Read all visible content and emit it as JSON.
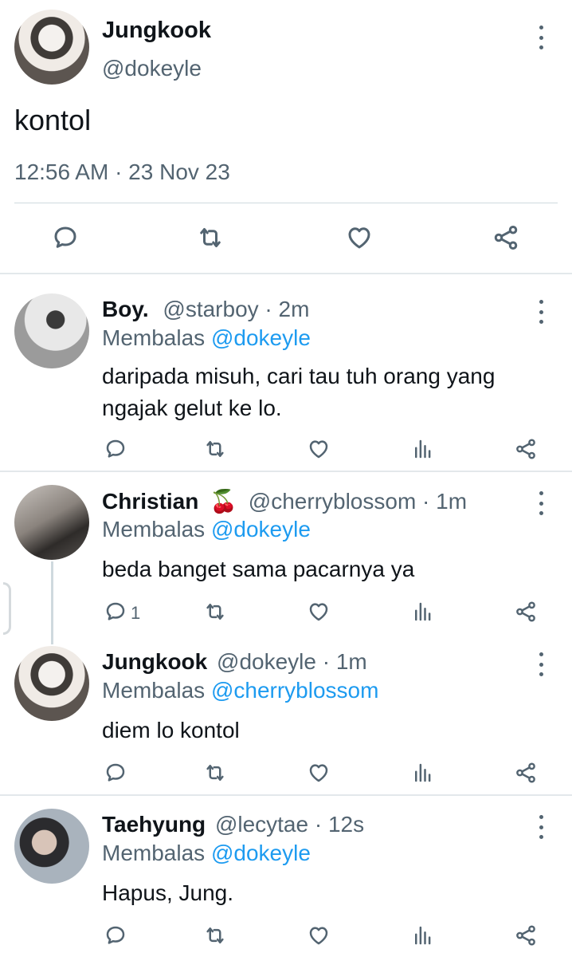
{
  "main_tweet": {
    "name": "Jungkook",
    "handle": "@dokeyle",
    "text": "kontol",
    "timestamp": "12:56 AM · 23 Nov 23",
    "actions": [
      "reply-icon",
      "retweet-icon",
      "like-icon",
      "share-icon"
    ]
  },
  "replies": [
    {
      "name": "Boy.",
      "meta": "@starboy · 2m",
      "reply_prefix": "Membalas",
      "reply_to": "@dokeyle",
      "text": "daripada misuh, cari tau tuh orang yang ngajak gelut ke lo.",
      "reply_count": ""
    },
    {
      "name": "Christian",
      "emoji": "🍒",
      "meta": "@cherryblossom · 1m",
      "reply_prefix": "Membalas",
      "reply_to": "@dokeyle",
      "text": "beda banget sama pacarnya ya",
      "reply_count": "1"
    },
    {
      "name": "Jungkook",
      "meta": "@dokeyle · 1m",
      "reply_prefix": "Membalas",
      "reply_to": "@cherryblossom",
      "text": "diem lo kontol",
      "reply_count": ""
    },
    {
      "name": "Taehyung",
      "meta": "@lecytae · 12s",
      "reply_prefix": "Membalas",
      "reply_to": "@dokeyle",
      "text": "Hapus, Jung.",
      "reply_count": ""
    }
  ],
  "colors": {
    "text": "#0f1419",
    "secondary": "#536471",
    "mention": "#1d9bf0",
    "divider": "#cfd9de"
  }
}
